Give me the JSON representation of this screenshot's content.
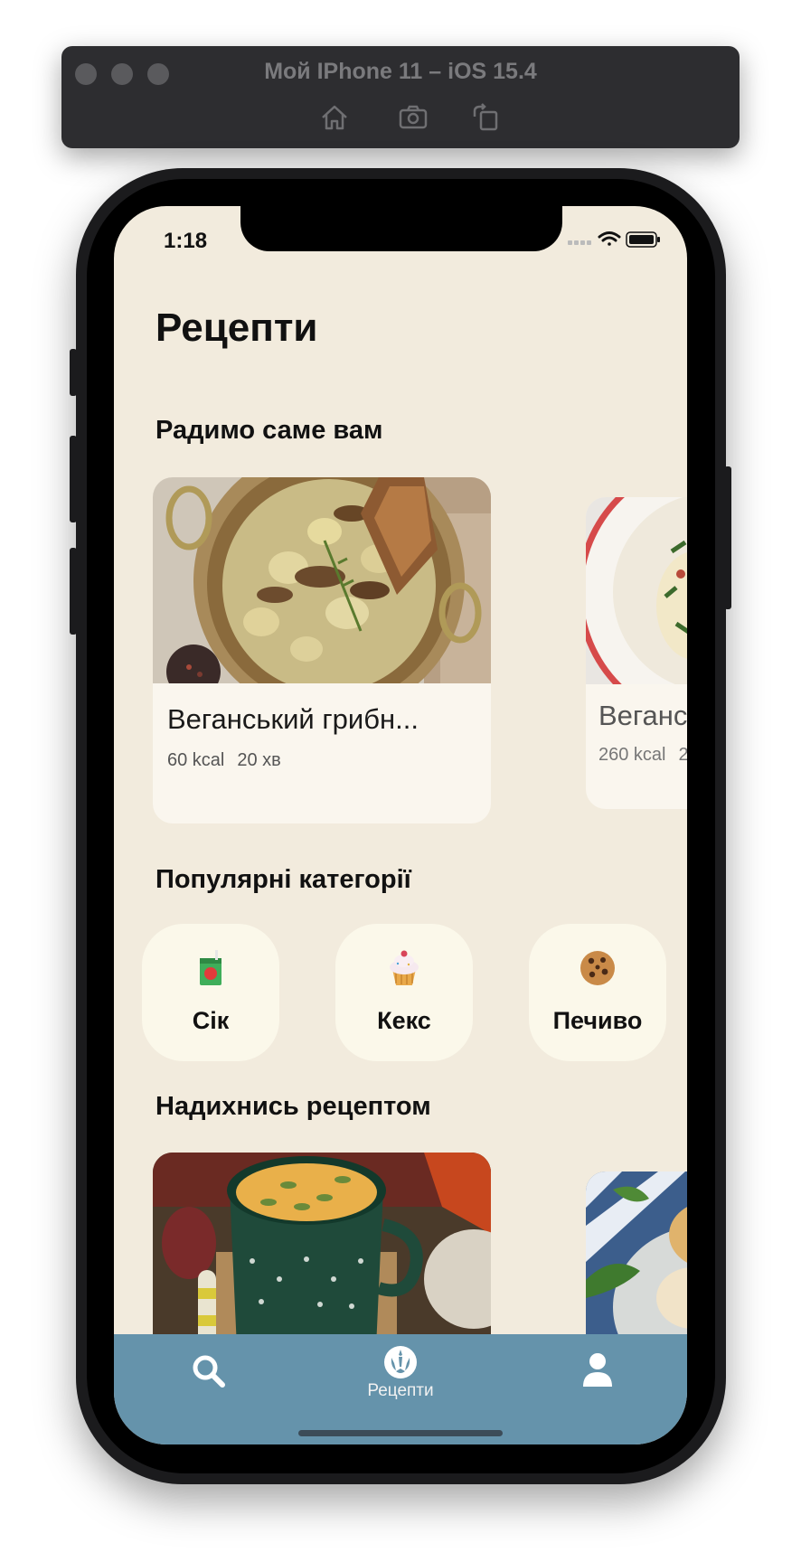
{
  "simulator": {
    "title": "Мой IPhone 11 – iOS 15.4",
    "toolbar": [
      "home-icon",
      "screenshot-icon",
      "rotate-icon"
    ]
  },
  "status_bar": {
    "time": "1:18"
  },
  "page": {
    "title": "Рецепти"
  },
  "recommended": {
    "title": "Радимо саме вам",
    "cards": [
      {
        "title": "Веганський грибн...",
        "kcal": "60 kcal",
        "time": "20 хв"
      },
      {
        "title": "Веганс",
        "kcal": "260 kcal",
        "time": "2"
      }
    ]
  },
  "categories": {
    "title": "Популярні категорії",
    "items": [
      {
        "label": "Сік",
        "icon": "juice-box-icon"
      },
      {
        "label": "Кекс",
        "icon": "cupcake-icon"
      },
      {
        "label": "Печиво",
        "icon": "cookie-icon"
      }
    ]
  },
  "inspire": {
    "title": "Надихнись рецептом"
  },
  "tab_bar": {
    "tabs": [
      {
        "icon": "search-icon",
        "label": ""
      },
      {
        "icon": "rebel-icon",
        "label": "Рецепти"
      },
      {
        "icon": "profile-icon",
        "label": ""
      }
    ]
  },
  "colors": {
    "background": "#f2ebdd",
    "tab_bar": "#6593ab",
    "card": "#faf6ee"
  }
}
